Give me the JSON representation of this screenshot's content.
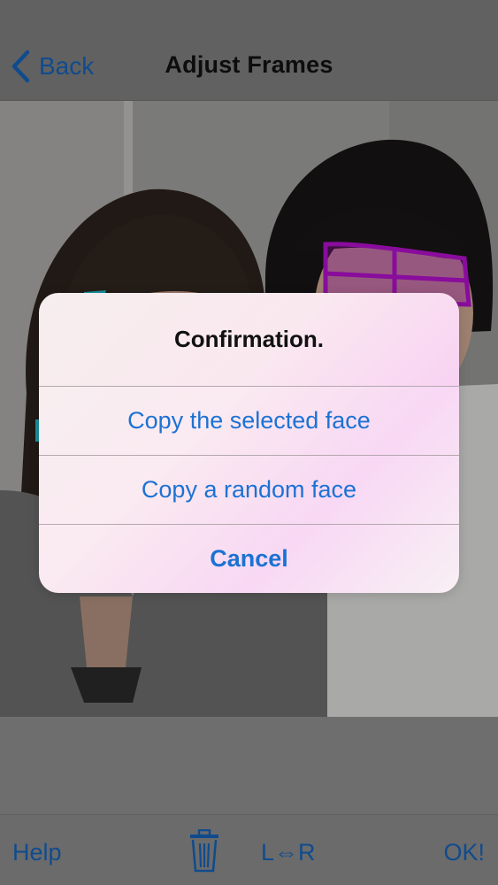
{
  "nav": {
    "back_label": "Back",
    "title": "Adjust Frames"
  },
  "alert": {
    "title": "Confirmation.",
    "buttons": [
      {
        "label": "Copy the selected face"
      },
      {
        "label": "Copy a random face"
      },
      {
        "label": "Cancel"
      }
    ]
  },
  "toolbar": {
    "help_label": "Help",
    "delete_icon": "trash-icon",
    "swap_label": "L⇔R",
    "ok_label": "OK!"
  },
  "colors": {
    "accent": "#1c72d4",
    "face_frame_selected": "#b010c8",
    "face_frame_other": "#20b8c8"
  }
}
